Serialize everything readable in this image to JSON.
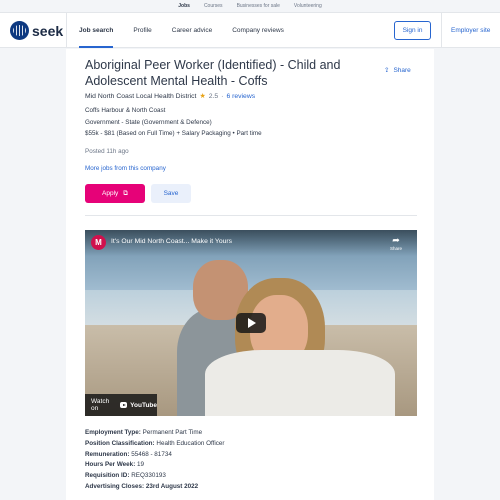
{
  "topbar": {
    "links": [
      "Jobs",
      "Courses",
      "Businesses for sale",
      "Volunteering"
    ]
  },
  "header": {
    "logo_text": "seek",
    "nav": [
      "Job search",
      "Profile",
      "Career advice",
      "Company reviews"
    ],
    "signin": "Sign in",
    "employer": "Employer site"
  },
  "job": {
    "title": "Aboriginal Peer Worker (Identified) - Child and Adolescent Mental Health - Coffs",
    "share": "Share",
    "company": "Mid North Coast Local Health District",
    "rating": "2.5",
    "reviews": "6 reviews",
    "location": "Coffs Harbour & North Coast",
    "classification": "Government - State (Government & Defence)",
    "salary_type": "$55k - $81 (Based on Full Time) + Salary Packaging  •  Part time",
    "posted": "Posted 11h ago",
    "more_jobs": "More jobs from this company",
    "apply": "Apply",
    "save": "Save"
  },
  "video": {
    "avatar_letter": "M",
    "title": "It's Our Mid North Coast... Make it Yours",
    "share_label": "Share",
    "watch_on": "Watch on",
    "youtube": "YouTube"
  },
  "details": [
    {
      "label": "Employment Type",
      "value": "Permanent Part Time"
    },
    {
      "label": "Position Classification",
      "value": "Health Education Officer"
    },
    {
      "label": "Remuneration",
      "value": "55468 - 81734"
    },
    {
      "label": "Hours Per Week",
      "value": "19"
    },
    {
      "label": "Requisition ID",
      "value": "REQ330193"
    },
    {
      "label": "Advertising Closes",
      "value": "23rd August 2022"
    }
  ],
  "colors": {
    "accent": "#2765cf",
    "apply": "#e60278",
    "brand": "#0d3880"
  }
}
